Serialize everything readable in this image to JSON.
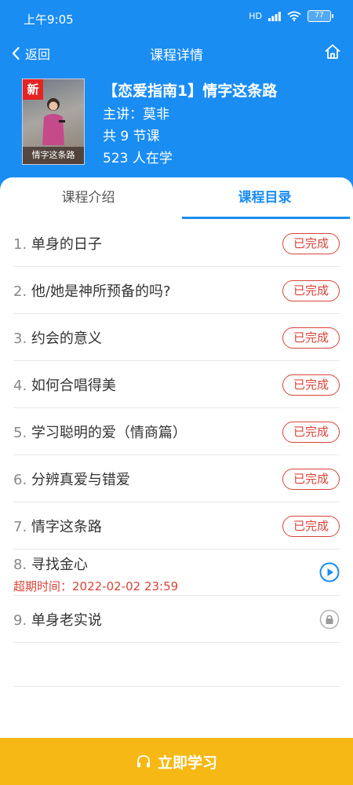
{
  "status_bar": {
    "time": "上午9:05",
    "network": "HD",
    "battery": "77"
  },
  "nav": {
    "back_label": "返回",
    "title": "课程详情"
  },
  "course": {
    "badge": "新",
    "cover_text": "情字这条路",
    "title": "【恋爱指南1】情字这条路",
    "lecturer": "主讲：莫非",
    "lesson_count": "共 9 节课",
    "learners": "523 人在学"
  },
  "tabs": {
    "intro": "课程介绍",
    "catalog": "课程目录",
    "active": "catalog"
  },
  "lessons": [
    {
      "num": "1.",
      "title": "单身的日子",
      "status": "已完成"
    },
    {
      "num": "2.",
      "title": "他/她是神所预备的吗?",
      "status": "已完成"
    },
    {
      "num": "3.",
      "title": "约会的意义",
      "status": "已完成"
    },
    {
      "num": "4.",
      "title": "如何合唱得美",
      "status": "已完成"
    },
    {
      "num": "5.",
      "title": "学习聪明的爱（情商篇）",
      "status": "已完成"
    },
    {
      "num": "6.",
      "title": "分辨真爱与错爱",
      "status": "已完成"
    },
    {
      "num": "7.",
      "title": "情字这条路",
      "status": "已完成"
    },
    {
      "num": "8.",
      "title": "寻找金心",
      "deadline": "超期时间：2022-02-02 23:59",
      "icon": "play-icon"
    },
    {
      "num": "9.",
      "title": "单身老实说",
      "icon": "lock-icon"
    }
  ],
  "bottom_button": {
    "label": "立即学习",
    "icon": "headphones-icon"
  },
  "colors": {
    "brand_blue": "#1a8df3",
    "status_red": "#d9443a",
    "action_yellow": "#f6b814"
  }
}
